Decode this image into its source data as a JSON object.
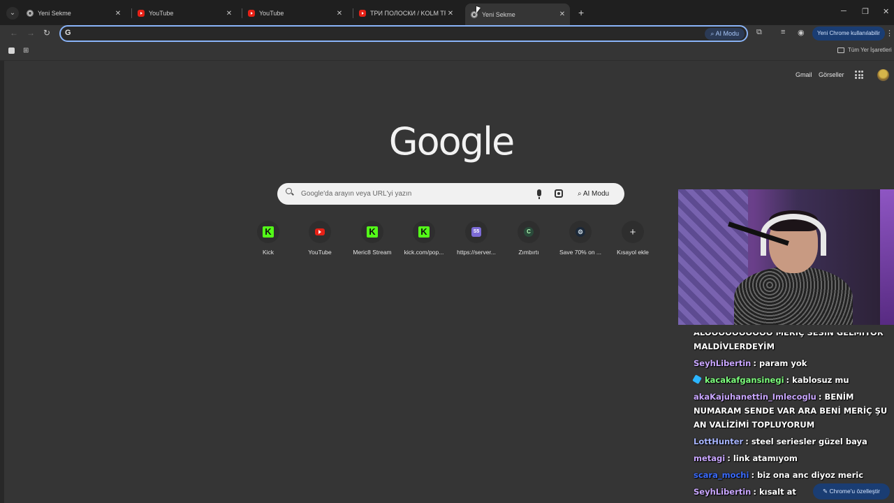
{
  "tabs": [
    {
      "title": "Yeni Sekme",
      "favicon": "chrome-icon"
    },
    {
      "title": "YouTube",
      "favicon": "youtube-icon"
    },
    {
      "title": "YouTube",
      "favicon": "youtube-icon"
    },
    {
      "title": "ТРИ ПОЛОСКИ / KOLM TRIIPU",
      "favicon": "youtube-icon"
    },
    {
      "title": "Yeni Sekme",
      "favicon": "chrome-icon",
      "active": true
    }
  ],
  "toolbar": {
    "omnibox_value": "",
    "ai_mode_label": "AI Modu",
    "update_label": "Yeni Chrome kullanılabilir"
  },
  "bookmarks": {
    "all_bookmarks_label": "Tüm Yer İşaretleri"
  },
  "ntp": {
    "links": [
      "Gmail",
      "Görseller"
    ],
    "logo_text": "Google",
    "search_placeholder": "Google'da arayın veya URL'yi yazın",
    "ai_mode_label": "AI Modu",
    "shortcuts": [
      {
        "label": "Kick",
        "icon": "kick-icon",
        "glyph": "K"
      },
      {
        "label": "YouTube",
        "icon": "youtube-icon",
        "glyph": ""
      },
      {
        "label": "Meric8 Stream",
        "icon": "kick-icon",
        "glyph": "K"
      },
      {
        "label": "kick.com/pop...",
        "icon": "kick-icon",
        "glyph": "K"
      },
      {
        "label": "https://server...",
        "icon": "s5-icon",
        "glyph": "S5"
      },
      {
        "label": "Zımbırtı",
        "icon": "c-icon",
        "glyph": "C"
      },
      {
        "label": "Save 70% on ...",
        "icon": "steam-icon",
        "glyph": "⚙"
      },
      {
        "label": "Kısayol ekle",
        "icon": "plus-icon",
        "glyph": "+"
      }
    ],
    "customize_label": "Chrome'u özelleştir"
  },
  "chat": {
    "messages": [
      {
        "user": "",
        "text": "ALOOOOOOOOOO MERİÇ SESİN GELMİYOR MALDİVLERDEYİM",
        "color": "#ffffff",
        "cut": true
      },
      {
        "user": "SeyhLibertin",
        "text": "param yok",
        "color": "#c9a6ff"
      },
      {
        "user": "kacakafgansinegi",
        "text": "kablosuz mu",
        "color": "#7dff7d",
        "badge": true
      },
      {
        "user": "akaKajuhanettin_Imlecoglu",
        "text": "BENİM NUMARAM SENDE VAR ARA BENİ MERİÇ ŞU AN VALİZİMİ TOPLUYORUM",
        "color": "#c9a6ff"
      },
      {
        "user": "LottHunter",
        "text": "steel seriesler güzel baya",
        "color": "#a7b5ff"
      },
      {
        "user": "metagi",
        "text": "link atamıyom",
        "color": "#c9a6ff"
      },
      {
        "user": "scara_mochi",
        "text": "biz ona anc diyoz meric",
        "color": "#3b6cff"
      },
      {
        "user": "SeyhLibertin",
        "text": "kısalt at",
        "color": "#c9a6ff"
      }
    ]
  },
  "colors": {
    "ntp_bg": "#353535",
    "accent": "#8ab4f8",
    "kick_green": "#53fc18"
  }
}
